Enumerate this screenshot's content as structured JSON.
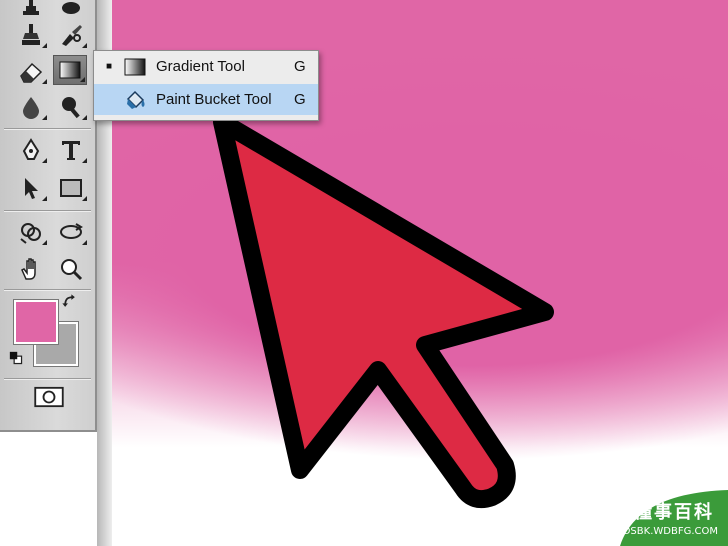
{
  "flyout": {
    "items": [
      {
        "bullet": "■",
        "label": "Gradient Tool",
        "shortcut": "G",
        "icon": "gradient-icon",
        "selected": true
      },
      {
        "bullet": "",
        "label": "Paint Bucket Tool",
        "shortcut": "G",
        "icon": "paint-bucket-icon",
        "highlighted": true
      }
    ]
  },
  "toolbar": {
    "tools": [
      "clone-stamp-icon",
      "history-brush-icon",
      "eraser-icon",
      "gradient-icon",
      "blur-icon",
      "dodge-icon",
      "pen-icon",
      "type-icon",
      "path-selection-icon",
      "rectangle-icon",
      "3d-rotate-icon",
      "3d-orbit-icon",
      "hand-icon",
      "zoom-icon",
      "switch-colors-icon",
      "default-colors-icon",
      "quick-mask-icon"
    ],
    "foreground_color": "#e066a6",
    "background_color": "#a9a9a9"
  },
  "watermark": {
    "title": "懂事百科",
    "url": "DSBK.WDBFG.COM"
  },
  "colors": {
    "canvas_pink": "#e066a6",
    "cursor_red": "#dd2a44",
    "highlight_blue": "#b8d6f3"
  }
}
